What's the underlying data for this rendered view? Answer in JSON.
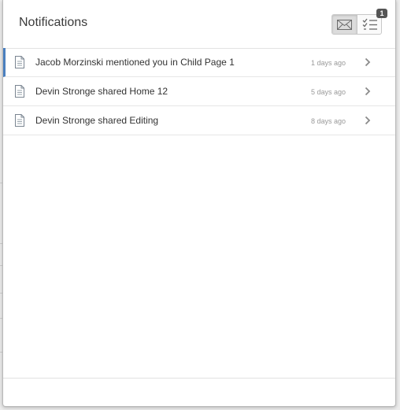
{
  "header": {
    "title": "Notifications",
    "views": [
      {
        "name": "notifications-view",
        "icon": "envelope-icon",
        "active": true
      },
      {
        "name": "tasks-view",
        "icon": "checklist-icon",
        "active": false,
        "badge": "1"
      }
    ]
  },
  "notifications": [
    {
      "text": "Jacob Morzinski mentioned you in Child Page 1",
      "time": "1 days ago",
      "icon": "document-icon",
      "unread": true
    },
    {
      "text": "Devin Stronge shared Home 12",
      "time": "5 days ago",
      "icon": "document-icon",
      "unread": false
    },
    {
      "text": "Devin Stronge shared Editing",
      "time": "8 days ago",
      "icon": "document-icon",
      "unread": false
    }
  ],
  "colors": {
    "unread_accent": "#4a7fbf",
    "badge_bg": "#555555",
    "time_text": "#999999"
  }
}
